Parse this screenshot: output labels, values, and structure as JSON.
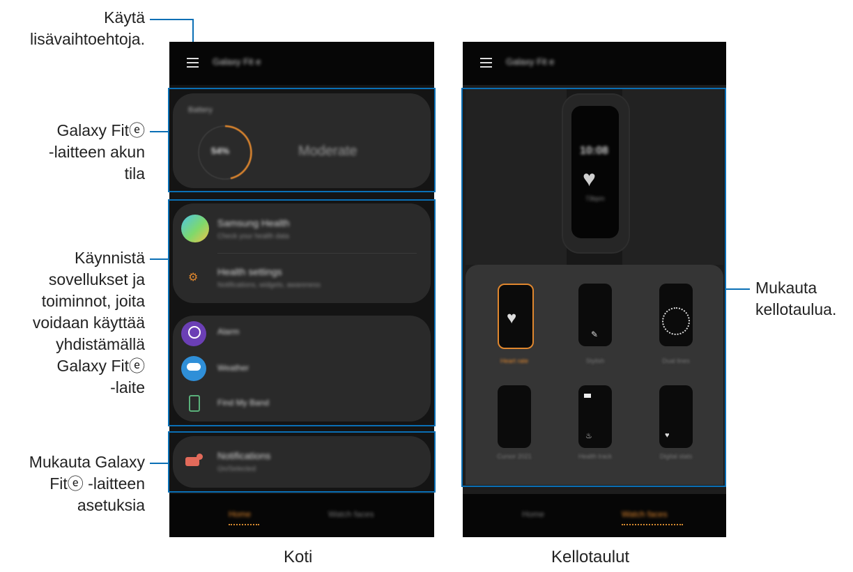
{
  "callouts": {
    "menu_line1": "Käytä",
    "menu_line2": "lisävaihtoehtoja.",
    "battery_line1": "Galaxy Fitⓔ",
    "battery_line2": "-laitteen akun",
    "battery_line3": "tila",
    "apps_line1": "Käynnistä",
    "apps_line2": "sovellukset ja",
    "apps_line3": "toiminnot, joita",
    "apps_line4": "voidaan käyttää",
    "apps_line5": "yhdistämällä",
    "apps_line6": "Galaxy Fitⓔ",
    "apps_line7": "-laite",
    "settings_line1": "Mukauta Galaxy",
    "settings_line2": "Fitⓔ -laitteen",
    "settings_line3": "asetuksia",
    "watchface_line1": "Mukauta",
    "watchface_line2": "kellotaulua."
  },
  "captions": {
    "home": "Koti",
    "watch_faces": "Kellotaulut"
  },
  "home_screen": {
    "title": "Galaxy Fit e",
    "battery_label": "Battery",
    "battery_percent": "54%",
    "battery_status": "Moderate",
    "samsung_health_title": "Samsung Health",
    "samsung_health_sub": "Check your health data",
    "health_settings_title": "Health settings",
    "health_settings_sub": "Notifications, widgets, awareness",
    "alarm_label": "Alarm",
    "weather_label": "Weather",
    "find_label": "Find My Band",
    "notifications_title": "Notifications",
    "notifications_sub": "On/Selected",
    "nav_home": "Home",
    "nav_watch_faces": "Watch faces"
  },
  "watch_screen": {
    "title": "Galaxy Fit e",
    "preview_time": "10:08",
    "preview_label": "73bpm",
    "faces": [
      "Heart rate",
      "Stylish",
      "Dual lines",
      "Cursor 2021",
      "Health track",
      "Digital stats"
    ],
    "nav_home": "Home",
    "nav_watch_faces": "Watch faces"
  },
  "colors": {
    "accent_orange": "#e0872e",
    "callout_blue": "#0a6fb5"
  }
}
